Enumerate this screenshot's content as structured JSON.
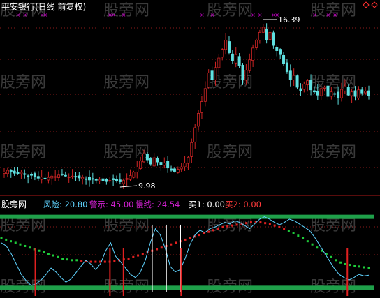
{
  "main": {
    "title": "平安银行(日线 前复权)",
    "max_label": "16.39",
    "min_label": "9.98"
  },
  "watermark": "股旁网",
  "indicator": {
    "brand": "股旁网",
    "items": [
      {
        "label": "风险: 20.80",
        "color": "#5fd3ff"
      },
      {
        "label": "警示: 45.00",
        "color": "#d020d0"
      },
      {
        "label": "慢线: 24.54",
        "color": "#d020d0"
      },
      {
        "label": "买1: 0.00",
        "color": "#ffffff"
      },
      {
        "label": "买2: 0.00",
        "color": "#ff3a3a"
      }
    ]
  },
  "colors": {
    "up": "#d02525",
    "down": "#5fe0e0",
    "marker": "#d000d0",
    "green": "#1fa04a",
    "risk": "#5fd3ff",
    "slow_green": "#1ecb3a",
    "slow_red": "#e02020",
    "grid": "#8b1a1a"
  },
  "chart_data": [
    {
      "type": "candlestick",
      "title": "平安银行(日线 前复权)",
      "annotations": [
        "16.39",
        "9.98"
      ],
      "price_high": 16.39,
      "price_low": 9.98,
      "close_series": [
        10.55,
        10.62,
        10.58,
        10.51,
        10.49,
        10.54,
        10.46,
        10.4,
        10.43,
        10.38,
        10.32,
        10.36,
        10.3,
        10.35,
        10.4,
        10.38,
        10.44,
        10.47,
        10.41,
        10.37,
        10.4,
        10.36,
        10.33,
        10.35,
        10.29,
        10.25,
        10.28,
        10.24,
        10.27,
        10.22,
        10.19,
        10.23,
        10.26,
        10.21,
        10.18,
        10.24,
        10.31,
        10.42,
        10.55,
        10.74,
        10.98,
        11.25,
        11.02,
        10.86,
        11.1,
        10.94,
        10.82,
        10.9,
        10.71,
        10.62,
        10.58,
        10.66,
        10.75,
        10.9,
        11.12,
        11.68,
        12.25,
        12.8,
        13.25,
        13.75,
        14.35,
        14.1,
        14.55,
        14.92,
        15.25,
        15.6,
        15.12,
        14.8,
        15.05,
        14.62,
        14.1,
        14.45,
        14.85,
        15.3,
        15.6,
        15.9,
        16.1,
        15.62,
        15.9,
        15.4,
        15.2,
        15.05,
        14.7,
        14.4,
        14.1,
        14.25,
        13.8,
        13.65,
        13.92,
        14.05,
        13.7,
        13.62,
        13.5,
        13.75,
        13.8,
        13.45,
        13.62,
        13.55,
        13.4,
        13.72,
        13.85,
        13.5,
        13.62,
        13.45,
        13.7,
        13.58,
        13.65,
        13.48
      ]
    },
    {
      "type": "line",
      "series": [
        {
          "name": "风险",
          "last": 20.8
        },
        {
          "name": "警示",
          "last": 45.0
        },
        {
          "name": "慢线",
          "last": 24.54
        },
        {
          "name": "买1",
          "last": 0.0
        },
        {
          "name": "买2",
          "last": 0.0
        }
      ],
      "risk": [
        62,
        58,
        48,
        35,
        22,
        14,
        8,
        10,
        15,
        22,
        30,
        25,
        18,
        12,
        16,
        24,
        32,
        40,
        35,
        28,
        36,
        52,
        62,
        45,
        38,
        30,
        22,
        18,
        25,
        40,
        62,
        80,
        72,
        55,
        32,
        25,
        28,
        42,
        60,
        72,
        78,
        75,
        80,
        82,
        85,
        88,
        86,
        90,
        88,
        84,
        80,
        86,
        92,
        95,
        92,
        88,
        85,
        88,
        92,
        90,
        86,
        82,
        78,
        70,
        60,
        50,
        40,
        30,
        22,
        18,
        15,
        18,
        22,
        20,
        21
      ],
      "slow_green": [
        68,
        66,
        64,
        62,
        60,
        58,
        56,
        54,
        52,
        50,
        48,
        46,
        44,
        42,
        41,
        40,
        40,
        39,
        39,
        38,
        38,
        38,
        38,
        38,
        39,
        40,
        41,
        42,
        44,
        46,
        48,
        50,
        52,
        54,
        56,
        58,
        60,
        62,
        64,
        66,
        68,
        70,
        72,
        74,
        76,
        78,
        80,
        82,
        83,
        84,
        85,
        86,
        87,
        88,
        88,
        88,
        87,
        86,
        84,
        82,
        80,
        77,
        74,
        71,
        68,
        64,
        60,
        56,
        52,
        48,
        44,
        40,
        37,
        35,
        34,
        33,
        32,
        31,
        30
      ],
      "slow_red_from": 17,
      "slow_red_to": 60,
      "buy1_bars": [
        32,
        35,
        38
      ],
      "buy2_bars": [
        10,
        32,
        36,
        53,
        102
      ],
      "green_levels": [
        95,
        5
      ]
    }
  ]
}
